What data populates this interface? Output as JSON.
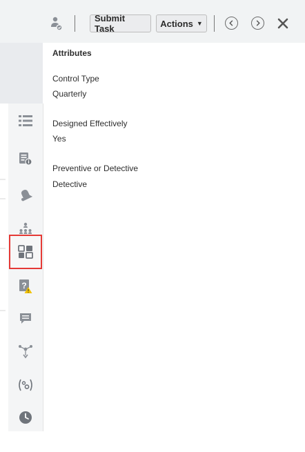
{
  "toolbar": {
    "submit_label": "Submit Task",
    "actions_label": "Actions"
  },
  "attributes": {
    "title": "Attributes",
    "items": [
      {
        "label": "Control Type",
        "value": "Quarterly"
      },
      {
        "label": "Designed Effectively",
        "value": "Yes"
      },
      {
        "label": "Preventive or Detective",
        "value": "Detective"
      }
    ]
  },
  "sidebar": {
    "items": [
      {
        "icon": "list-icon"
      },
      {
        "icon": "task-details-icon"
      },
      {
        "icon": "alert-bell-icon"
      },
      {
        "icon": "hierarchy-icon"
      },
      {
        "icon": "attributes-grid-icon",
        "selected": true
      },
      {
        "icon": "question-warning-icon"
      },
      {
        "icon": "comment-icon"
      },
      {
        "icon": "workflow-icon"
      },
      {
        "icon": "parameters-icon"
      },
      {
        "icon": "history-clock-icon"
      }
    ]
  },
  "colors": {
    "selected_outline": "#e53935",
    "icon_gray": "#8a8f96",
    "toolbar_bg": "#f1f3f4"
  }
}
